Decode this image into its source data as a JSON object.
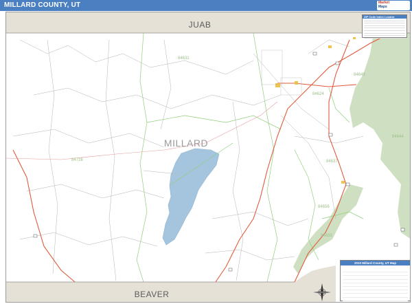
{
  "title": "MILLARD COUNTY, UT",
  "colors": {
    "title_bar": "#4a7fc1",
    "neighbor_county": "#e6e1d6",
    "national_forest": "#cfe0c2",
    "lake": "#a5c5de",
    "highway": "#e05a3a",
    "zip_boundary": "#8fcf7a",
    "road": "#9a9a9a"
  },
  "map": {
    "neighbor_north": "JUAB",
    "neighbor_south": "BEAVER",
    "county_label": "MILLARD",
    "zip_labels": [
      "84631",
      "84649",
      "84624",
      "84728",
      "84637",
      "84644",
      "84656",
      "84633"
    ],
    "zip_legend_title": "ZIP Code Index Locator",
    "legend_title": "2010 Millard County, UT Map"
  },
  "icons": [
    "compass-rose-icon",
    "map-logo"
  ]
}
